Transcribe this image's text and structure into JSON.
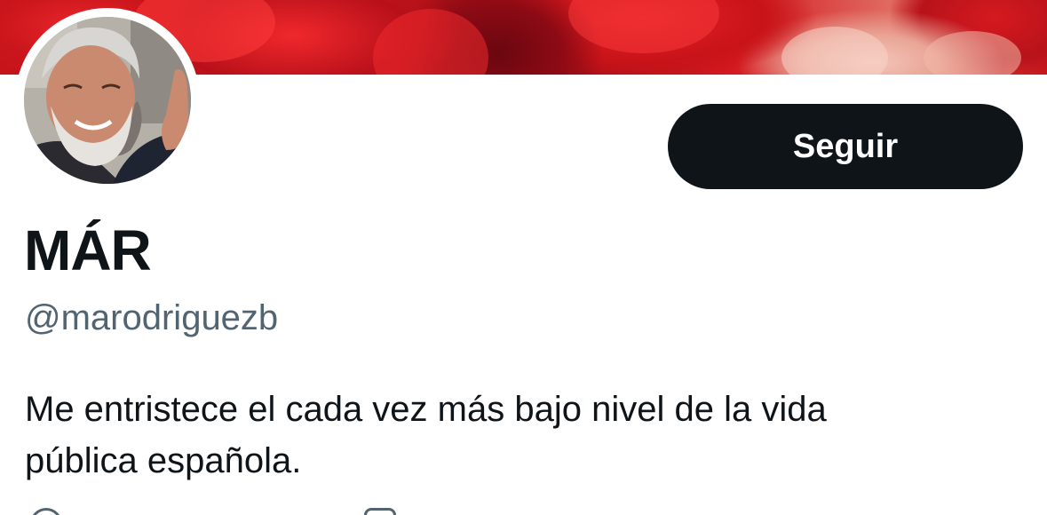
{
  "profile": {
    "display_name": "MÁR",
    "handle": "@marodriguezb",
    "bio_lines": [
      "Me entristece el cada vez más bajo nivel de la vida",
      "pública española."
    ]
  },
  "actions": {
    "follow_label": "Seguir"
  },
  "icons": {
    "banner": "red-flowers-banner-image",
    "avatar": "profile-photo",
    "meta_left": "location-icon",
    "meta_right": "link-icon"
  },
  "colors": {
    "button_bg": "#0f1419",
    "button_text": "#ffffff",
    "name_text": "#0f1419",
    "handle_text": "#536471",
    "banner_red": "#d81c21"
  }
}
